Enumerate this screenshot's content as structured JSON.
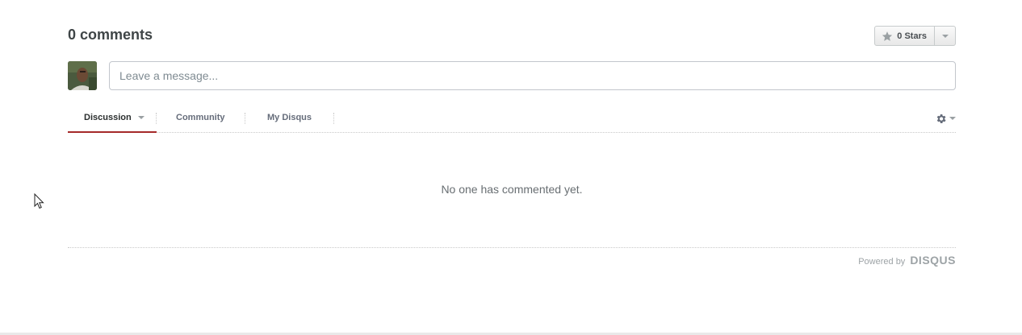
{
  "thread": {
    "comment_count": "0 comments",
    "stars": {
      "label": "0 Stars",
      "icon": "star-icon"
    },
    "composer": {
      "placeholder": "Leave a message..."
    }
  },
  "nav": {
    "tabs": [
      {
        "label": "Discussion",
        "active": true
      },
      {
        "label": "Community",
        "active": false
      },
      {
        "label": "My Disqus",
        "active": false
      }
    ],
    "settings_icon": "gear-icon"
  },
  "empty_state": "No one has commented yet.",
  "footer": {
    "powered_by": "Powered by",
    "brand": "DISQUS"
  },
  "colors": {
    "active_tab_underline": "#a52a2a",
    "text_muted": "#686e72"
  }
}
